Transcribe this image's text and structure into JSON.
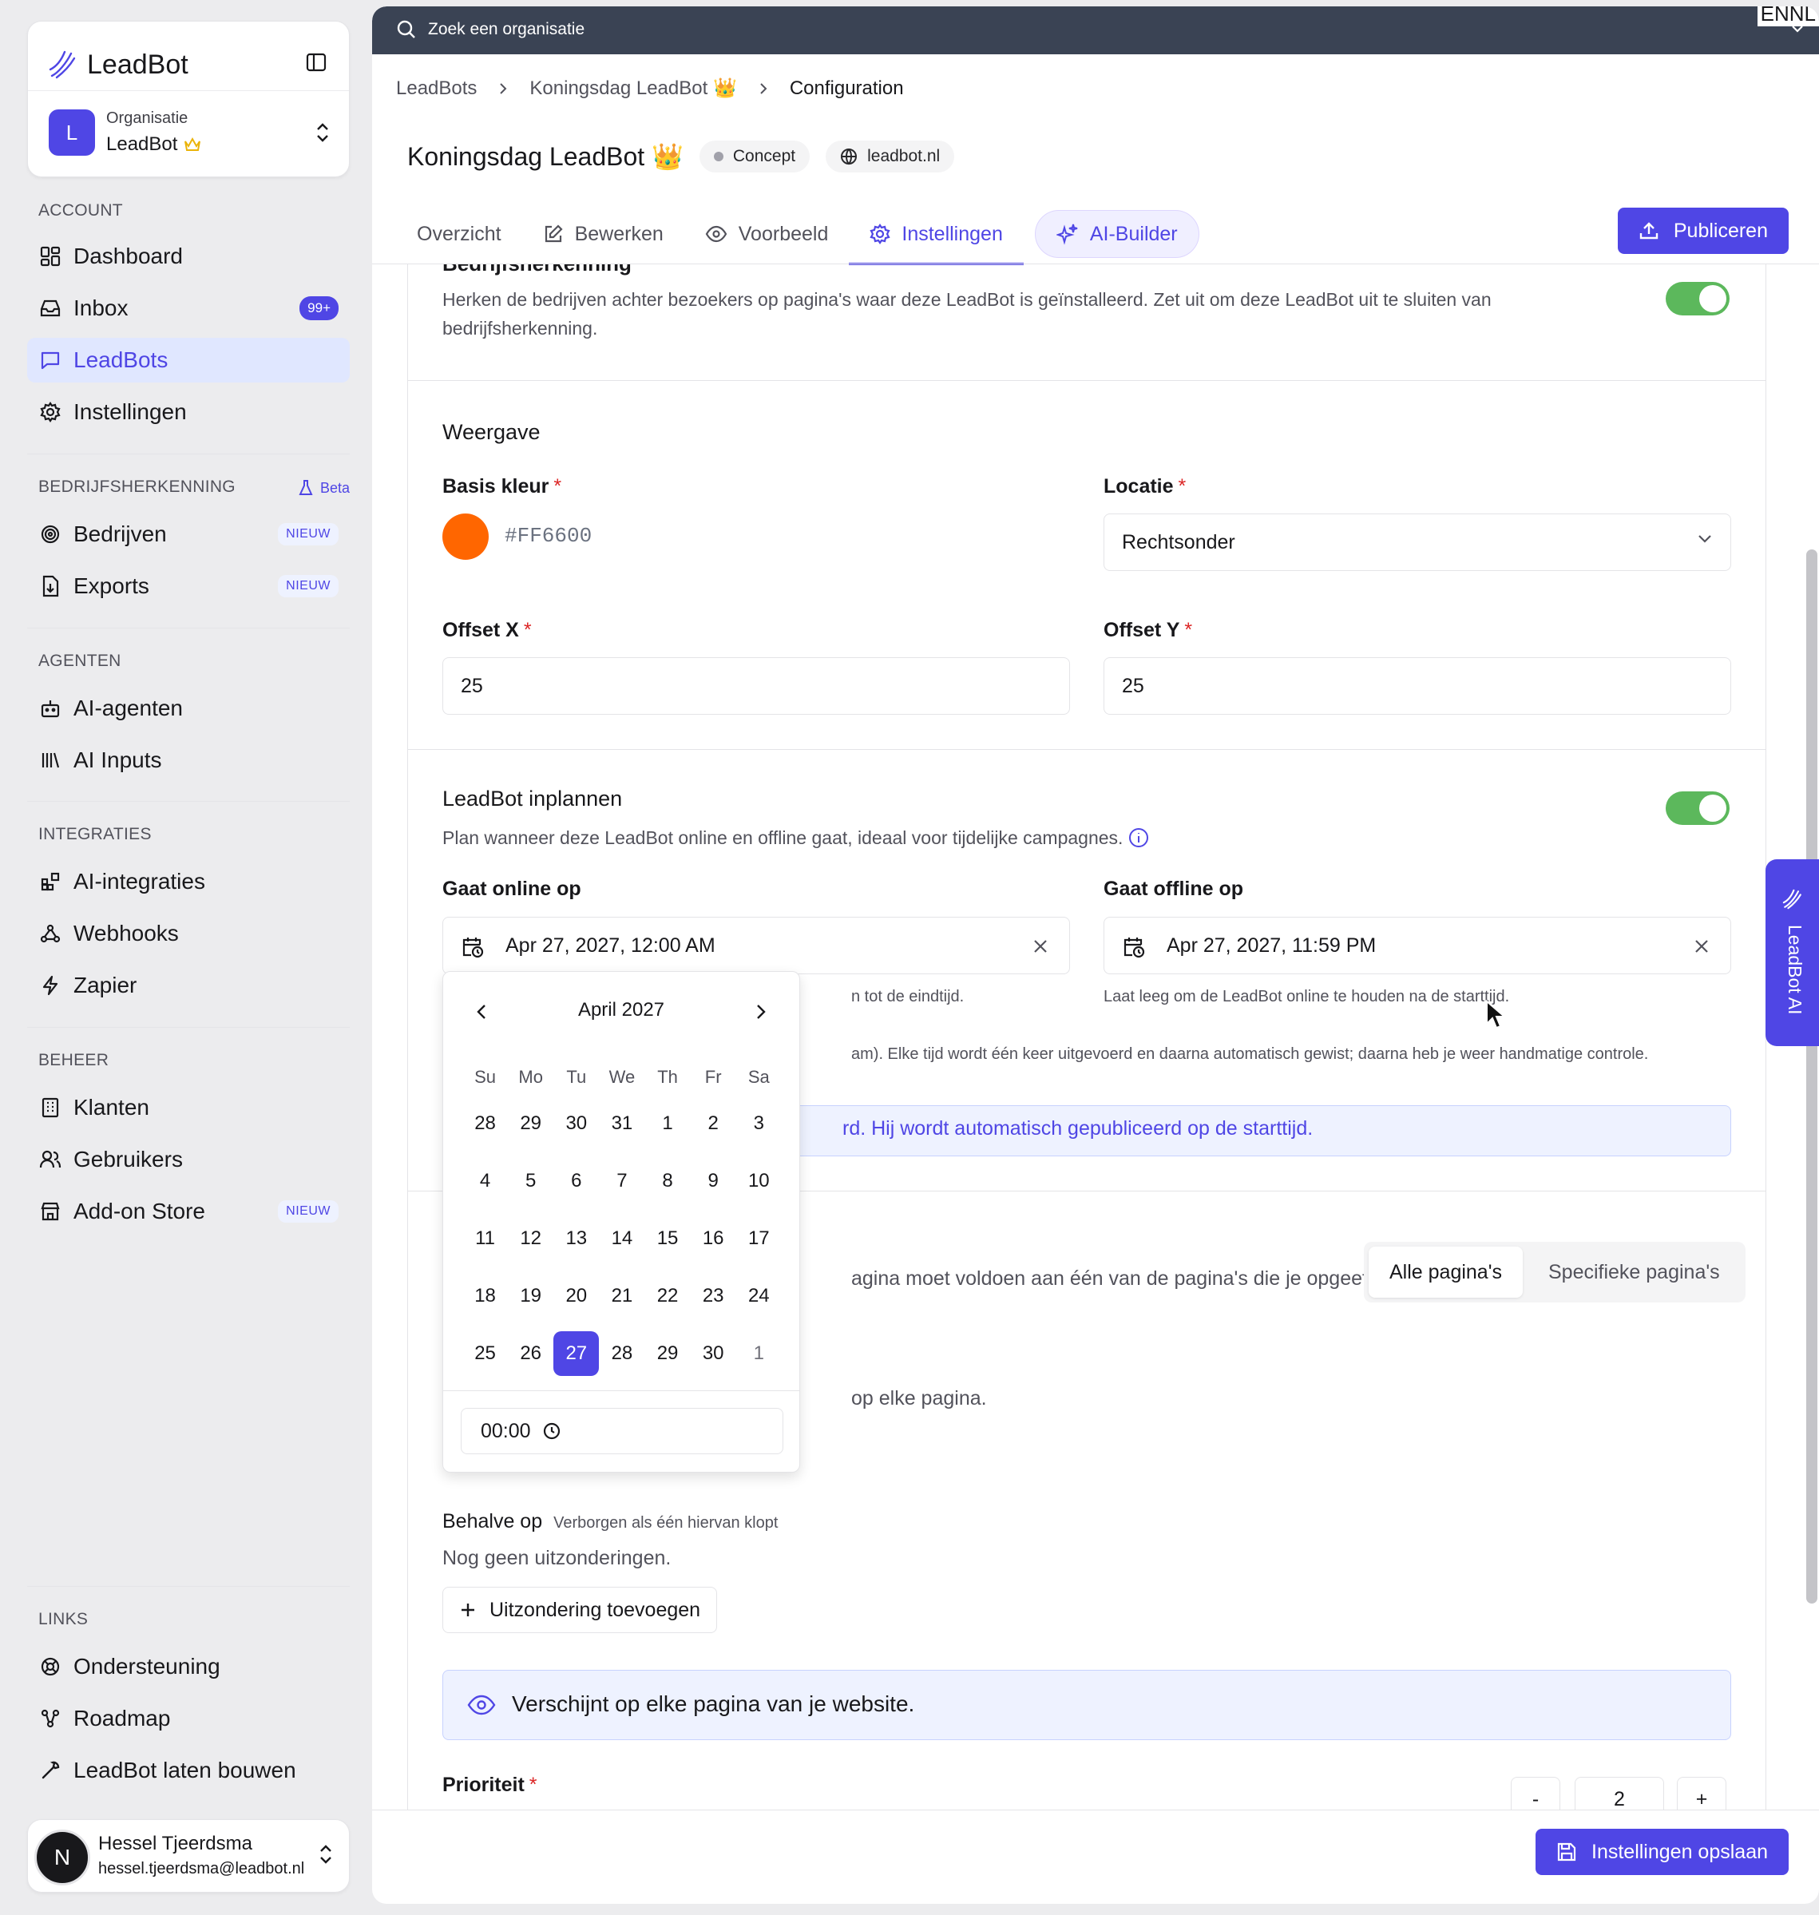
{
  "app": {
    "name": "LeadBot"
  },
  "org": {
    "label": "Organisatie",
    "name": "LeadBot"
  },
  "sidebar": {
    "account_title": "ACCOUNT",
    "account": [
      {
        "label": "Dashboard",
        "icon": "dashboard-icon"
      },
      {
        "label": "Inbox",
        "icon": "inbox-icon",
        "badge": "99+"
      },
      {
        "label": "LeadBots",
        "icon": "chat-icon",
        "active": true
      },
      {
        "label": "Instellingen",
        "icon": "gear-icon"
      }
    ],
    "bedrijf_title": "BEDRIJFSHERKENNING",
    "beta": "Beta",
    "bedrijf": [
      {
        "label": "Bedrijven",
        "icon": "target-icon",
        "tag": "NIEUW"
      },
      {
        "label": "Exports",
        "icon": "file-export-icon",
        "tag": "NIEUW"
      }
    ],
    "agenten_title": "AGENTEN",
    "agenten": [
      {
        "label": "AI-agenten",
        "icon": "robot-icon"
      },
      {
        "label": "AI Inputs",
        "icon": "library-icon"
      }
    ],
    "integraties_title": "INTEGRATIES",
    "integraties": [
      {
        "label": "AI-integraties",
        "icon": "blocks-icon"
      },
      {
        "label": "Webhooks",
        "icon": "webhook-icon"
      },
      {
        "label": "Zapier",
        "icon": "bolt-icon"
      }
    ],
    "beheer_title": "BEHEER",
    "beheer": [
      {
        "label": "Klanten",
        "icon": "building-icon"
      },
      {
        "label": "Gebruikers",
        "icon": "users-icon"
      },
      {
        "label": "Add-on Store",
        "icon": "store-icon",
        "tag": "NIEUW"
      }
    ],
    "links_title": "LINKS",
    "links": [
      {
        "label": "Ondersteuning",
        "icon": "lifebuoy-icon"
      },
      {
        "label": "Roadmap",
        "icon": "roadmap-icon"
      },
      {
        "label": "LeadBot laten bouwen",
        "icon": "wrench-icon"
      }
    ]
  },
  "user": {
    "initial": "N",
    "name": "Hessel Tjeerdsma",
    "email": "hessel.tjeerdsma@leadbot.nl"
  },
  "topbar": {
    "search_placeholder": "Zoek een organisatie",
    "lang": "ENNL"
  },
  "breadcrumb": [
    "LeadBots",
    "Koningsdag LeadBot 👑",
    "Configuration"
  ],
  "page": {
    "title": "Koningsdag LeadBot 👑",
    "status": "Concept",
    "domain": "leadbot.nl"
  },
  "tabs": [
    "Overzicht",
    "Bewerken",
    "Voorbeeld",
    "Instellingen",
    "AI-Builder"
  ],
  "active_tab": "Instellingen",
  "publish_label": "Publiceren",
  "bedrijfsherkenning": {
    "title": "Bedrijfsherkenning",
    "desc": "Herken de bedrijven achter bezoekers op pagina's waar deze LeadBot is geïnstalleerd. Zet uit om deze LeadBot uit te sluiten van bedrijfsherkenning.",
    "enabled": true
  },
  "weergave": {
    "title": "Weergave",
    "basis_kleur_label": "Basis kleur",
    "basis_kleur": "#FF6600",
    "locatie_label": "Locatie",
    "locatie": "Rechtsonder",
    "offset_x_label": "Offset X",
    "offset_x": "25",
    "offset_y_label": "Offset Y",
    "offset_y": "25"
  },
  "inplannen": {
    "title": "LeadBot inplannen",
    "desc": "Plan wanneer deze LeadBot online en offline gaat, ideaal voor tijdelijke campagnes.",
    "enabled": true,
    "online_label": "Gaat online op",
    "online_value": "Apr 27, 2027, 12:00 AM",
    "online_help": "n tot de eindtijd.",
    "offline_label": "Gaat offline op",
    "offline_value": "Apr 27, 2027, 11:59 PM",
    "offline_help": "Laat leeg om de LeadBot online te houden na de starttijd.",
    "note": "am). Elke tijd wordt één keer uitgevoerd en daarna automatisch gewist; daarna heb je weer handmatige controle.",
    "info": "rd. Hij wordt automatisch gepubliceerd op de starttijd."
  },
  "calendar": {
    "month": "April 2027",
    "weekdays": [
      "Su",
      "Mo",
      "Tu",
      "We",
      "Th",
      "Fr",
      "Sa"
    ],
    "weeks": [
      [
        "28",
        "29",
        "30",
        "31",
        "1",
        "2",
        "3"
      ],
      [
        "4",
        "5",
        "6",
        "7",
        "8",
        "9",
        "10"
      ],
      [
        "11",
        "12",
        "13",
        "14",
        "15",
        "16",
        "17"
      ],
      [
        "18",
        "19",
        "20",
        "21",
        "22",
        "23",
        "24"
      ],
      [
        "25",
        "26",
        "27",
        "28",
        "29",
        "30",
        "1"
      ]
    ],
    "selected": "27",
    "time": "00:00"
  },
  "paginas": {
    "desc": "agina moet voldoen aan één van de pagina's die je opgeeft, en",
    "options": [
      "Alle pagina's",
      "Specifieke pagina's"
    ],
    "selected": "Alle pagina's",
    "every_page": "op elke pagina.",
    "behalve_label": "Behalve op",
    "behalve_hint": "Verborgen als één hiervan klopt",
    "no_exceptions": "Nog geen uitzonderingen.",
    "add_exception": "Uitzondering toevoegen",
    "info": "Verschijnt op elke pagina van je website."
  },
  "prioriteit": {
    "label": "Prioriteit",
    "value": "2",
    "minus": "-",
    "plus": "+"
  },
  "save_label": "Instellingen opslaan",
  "side_tab": "LeadBot AI",
  "colors": {
    "accent": "#4f46e5",
    "toggle_on": "#5cb85c",
    "swatch": "#FF6600",
    "topbar": "#3a4354"
  }
}
